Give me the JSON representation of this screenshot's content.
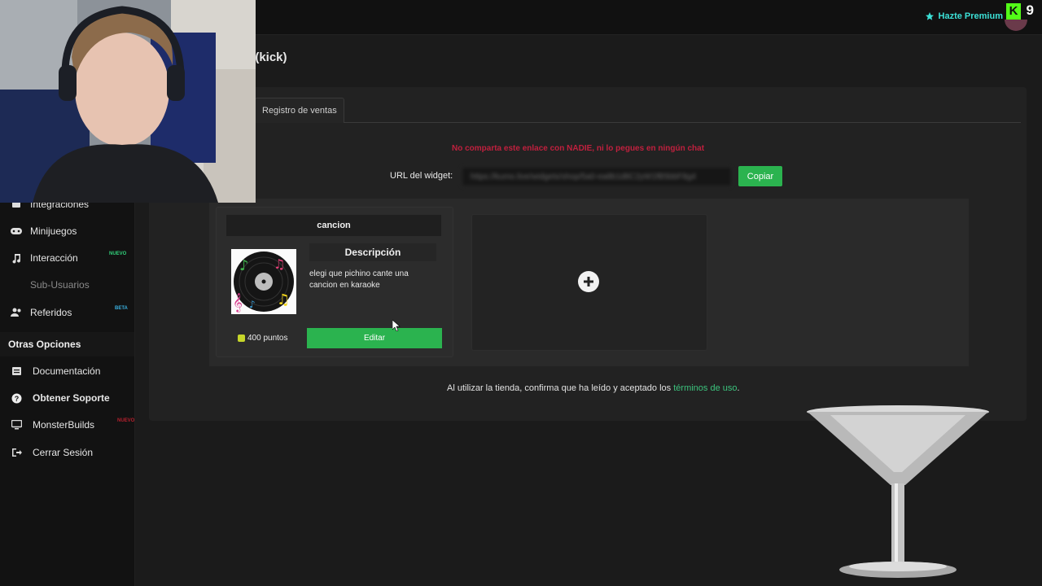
{
  "header": {
    "premium_label": "Hazte Premium",
    "kick_letter": "K",
    "kick_count": "9"
  },
  "page": {
    "title": "d (kick)"
  },
  "tabs": [
    {
      "label": "Registro de ventas"
    }
  ],
  "sidebar": {
    "items": [
      {
        "label": "Integraciones",
        "icon": "plug-icon"
      },
      {
        "label": "Minijuegos",
        "icon": "gamepad-icon"
      },
      {
        "label": "Interacción",
        "icon": "music-note-icon",
        "badge": "NUEVO"
      },
      {
        "label": "Sub-Usuarios",
        "icon": "",
        "disabled": true
      },
      {
        "label": "Referidos",
        "icon": "users-icon",
        "badge": "BETA"
      }
    ],
    "section_title": "Otras Opciones",
    "options": [
      {
        "label": "Documentación",
        "icon": "docs-icon"
      },
      {
        "label": "Obtener Soporte",
        "icon": "question-icon"
      },
      {
        "label": "MonsterBuilds",
        "icon": "monitor-icon",
        "badge": "NUEVO"
      },
      {
        "label": "Cerrar Sesión",
        "icon": "logout-icon"
      }
    ]
  },
  "widget": {
    "warning": "No comparta este enlace con NADIE, ni lo pegues en ningún chat",
    "url_label": "URL del widget:",
    "url_value": "https://kumo.live/widgets/shop/5a0-ea8b1d8C2yW1fB5bbF8g4",
    "copy_label": "Copiar"
  },
  "items": [
    {
      "title": "cancion",
      "description_title": "Descripción",
      "description": "elegi que pichino cante una cancion en karaoke",
      "points": "400 puntos",
      "edit_label": "Editar",
      "image": "music-record-icon"
    }
  ],
  "footer": {
    "terms_text": "Al utilizar la tienda, confirma que ha leído y aceptado los",
    "terms_link": "términos de uso",
    "terms_end": "."
  },
  "colors": {
    "accent_green": "#2bb34f",
    "warning_red": "#c0203e",
    "premium_cyan": "#3ce0d6",
    "kick_green": "#53fc18"
  }
}
